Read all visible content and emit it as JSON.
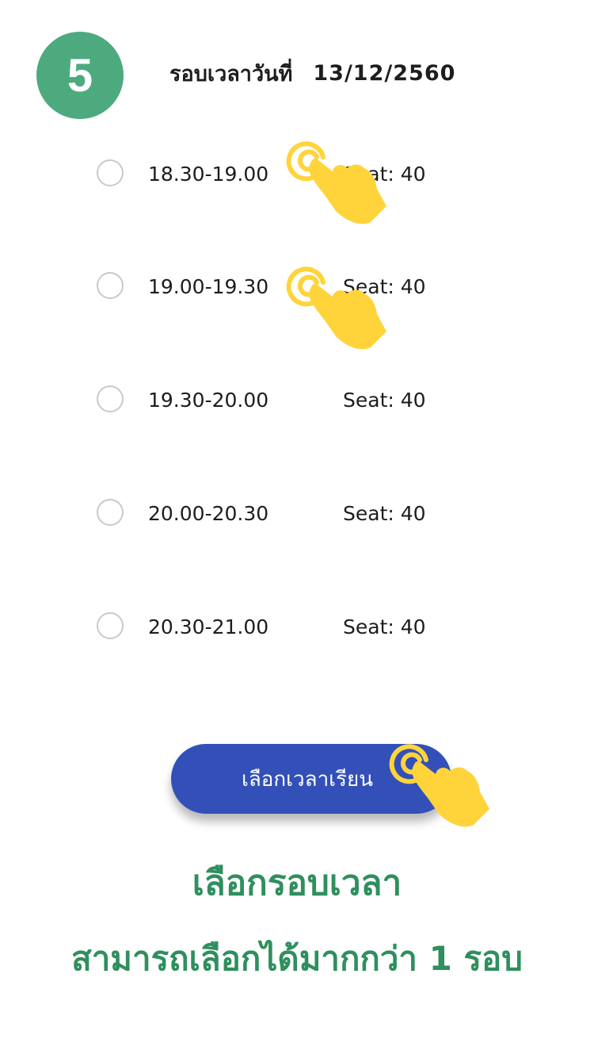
{
  "step": {
    "number": "5"
  },
  "header": {
    "title": "รอบเวลาวันที่",
    "date": "13/12/2560"
  },
  "slots": [
    {
      "time": "18.30-19.00",
      "seat": "Seat: 40"
    },
    {
      "time": "19.00-19.30",
      "seat": "Seat: 40"
    },
    {
      "time": "19.30-20.00",
      "seat": "Seat: 40"
    },
    {
      "time": "20.00-20.30",
      "seat": "Seat: 40"
    },
    {
      "time": "20.30-21.00",
      "seat": "Seat: 40"
    }
  ],
  "button": {
    "label": "เลือกเวลาเรียน"
  },
  "caption": {
    "line1": "เลือกรอบเวลา",
    "line2": "สามารถเลือกได้มากกว่า 1 รอบ"
  },
  "icons": {
    "tap": "tap-hand-icon"
  },
  "colors": {
    "badge": "#4daa7f",
    "button": "#3350b8",
    "caption": "#2f8f5e",
    "hand": "#ffd43b"
  }
}
